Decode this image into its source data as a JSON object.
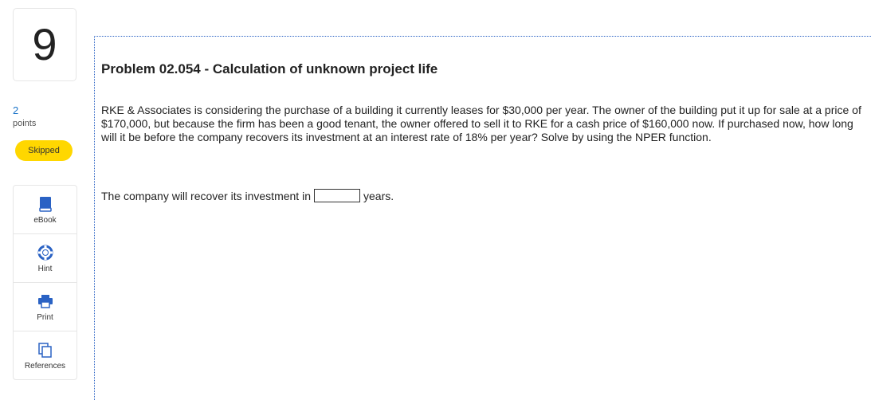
{
  "question": {
    "number": "9",
    "points_value": "2",
    "points_label": "points",
    "status": "Skipped"
  },
  "tools": [
    {
      "label": "eBook",
      "icon": "book-icon"
    },
    {
      "label": "Hint",
      "icon": "lifebuoy-icon"
    },
    {
      "label": "Print",
      "icon": "printer-icon"
    },
    {
      "label": "References",
      "icon": "copy-icon"
    }
  ],
  "problem": {
    "title": "Problem 02.054 - Calculation of unknown project life",
    "text": "RKE & Associates is considering the purchase of a building it currently leases for $30,000 per year. The owner of the building put it up for sale at a price of $170,000, but because the firm has been a good tenant, the owner offered to sell it to RKE for a cash price of $160,000 now. If purchased now, how long will it be before the company recovers its investment at an interest rate of 18% per year? Solve by using the NPER function.",
    "answer_prefix": "The company will recover its investment in",
    "answer_value": "",
    "answer_suffix": "years."
  },
  "colors": {
    "badge": "#ffd700",
    "points": "#1a73c8",
    "icon": "#2a62c4",
    "border_dotted": "#2a62c4"
  }
}
